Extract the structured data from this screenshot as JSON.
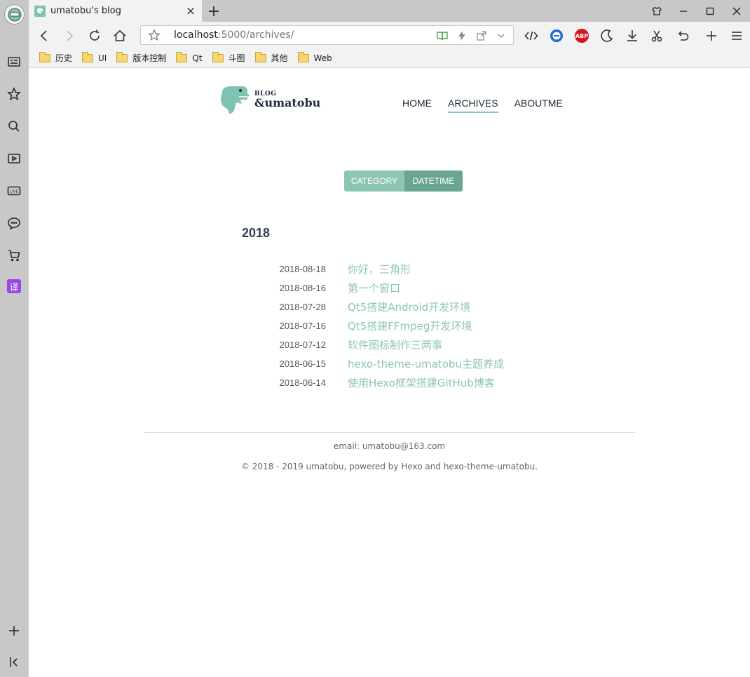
{
  "browser": {
    "tab": {
      "title": "umatobu's blog"
    },
    "url": {
      "host": "localhost",
      "rest": ":5000/archives/"
    },
    "bookmarks": [
      "历史",
      "UI",
      "版本控制",
      "Qt",
      "斗图",
      "其他",
      "Web"
    ],
    "abp_label": "ABP",
    "translate_label": "译"
  },
  "site": {
    "logo": {
      "small": "BLOG",
      "big": "&umatobu"
    },
    "nav": {
      "home": "HOME",
      "archives": "ARCHIVES",
      "aboutme": "ABOUTME"
    },
    "switcher": {
      "category": "CATEGORY",
      "datetime": "DATETIME"
    },
    "year": "2018",
    "posts": [
      {
        "date": "2018-08-18",
        "title": "你好，三角形"
      },
      {
        "date": "2018-08-16",
        "title": "第一个窗口"
      },
      {
        "date": "2018-07-28",
        "title": "Qt5搭建Android开发环境"
      },
      {
        "date": "2018-07-16",
        "title": "Qt5搭建FFmpeg开发环境"
      },
      {
        "date": "2018-07-12",
        "title": "软件图标制作三两事"
      },
      {
        "date": "2018-06-15",
        "title": "hexo-theme-umatobu主题养成"
      },
      {
        "date": "2018-06-14",
        "title": "使用Hexo框架搭建GitHub博客"
      }
    ],
    "footer": {
      "email": "email: umatobu@163.com",
      "copyright": "© 2018 - 2019 umatobu, powered by Hexo and hexo-theme-umatobu."
    }
  },
  "colors": {
    "accent": "#8dc5b5",
    "accent_dark": "#6aa593",
    "text_dark": "#1f2a3a"
  }
}
